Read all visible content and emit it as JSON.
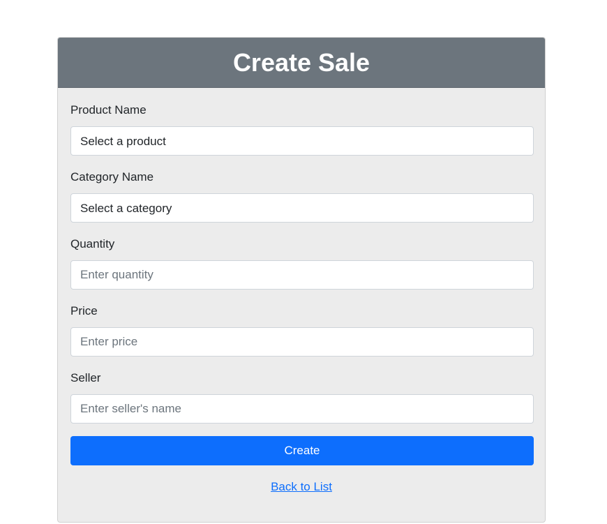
{
  "header": {
    "title": "Create Sale"
  },
  "form": {
    "product": {
      "label": "Product Name",
      "selected": "Select a product"
    },
    "category": {
      "label": "Category Name",
      "selected": "Select a category"
    },
    "quantity": {
      "label": "Quantity",
      "placeholder": "Enter quantity"
    },
    "price": {
      "label": "Price",
      "placeholder": "Enter price"
    },
    "seller": {
      "label": "Seller",
      "placeholder": "Enter seller's name"
    },
    "submit_label": "Create"
  },
  "footer": {
    "back_link": "Back to List"
  },
  "colors": {
    "header_bg": "#6c757d",
    "card_bg": "#ececec",
    "primary": "#0d6efd"
  }
}
